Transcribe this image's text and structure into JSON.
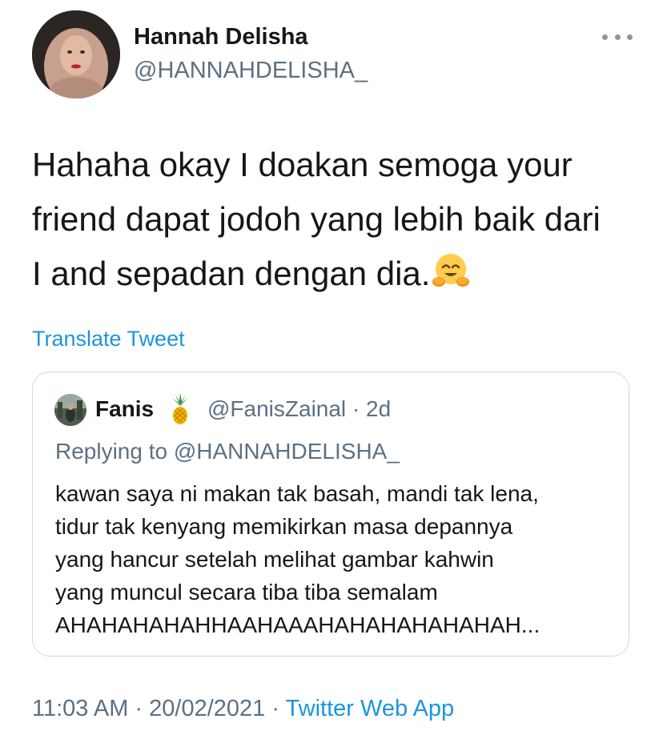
{
  "author": {
    "name": "Hannah Delisha",
    "handle": "@HANNAHDELISHA_"
  },
  "tweet": {
    "lines": [
      "Hahaha okay I doakan semoga your",
      "friend dapat jodoh yang lebih baik dari",
      "I and sepadan dengan dia."
    ],
    "translate_label": "Translate Tweet"
  },
  "quoted": {
    "name": "Fanis",
    "name_emoji_icon": "pineapple-icon",
    "meta": "@FanisZainal · 2d",
    "replying_to": "Replying to @HANNAHDELISHA_",
    "lines": [
      "kawan saya ni makan tak basah, mandi tak lena,",
      "tidur tak kenyang memikirkan masa depannya",
      "yang hancur setelah melihat gambar kahwin",
      "yang muncul secara tiba tiba semalam",
      "AHAHAHAHAHHAAHAAAHAHAHAHAHAHAH..."
    ]
  },
  "footer": {
    "timestamp": "11:03 AM · 20/02/2021 · ",
    "source": "Twitter Web App"
  },
  "colors": {
    "link": "#1b95e0",
    "secondary_text": "#5b7083",
    "border": "#cfd9de"
  },
  "icons": [
    "more-options-icon",
    "hugging-face-emoji-icon",
    "pineapple-icon"
  ]
}
